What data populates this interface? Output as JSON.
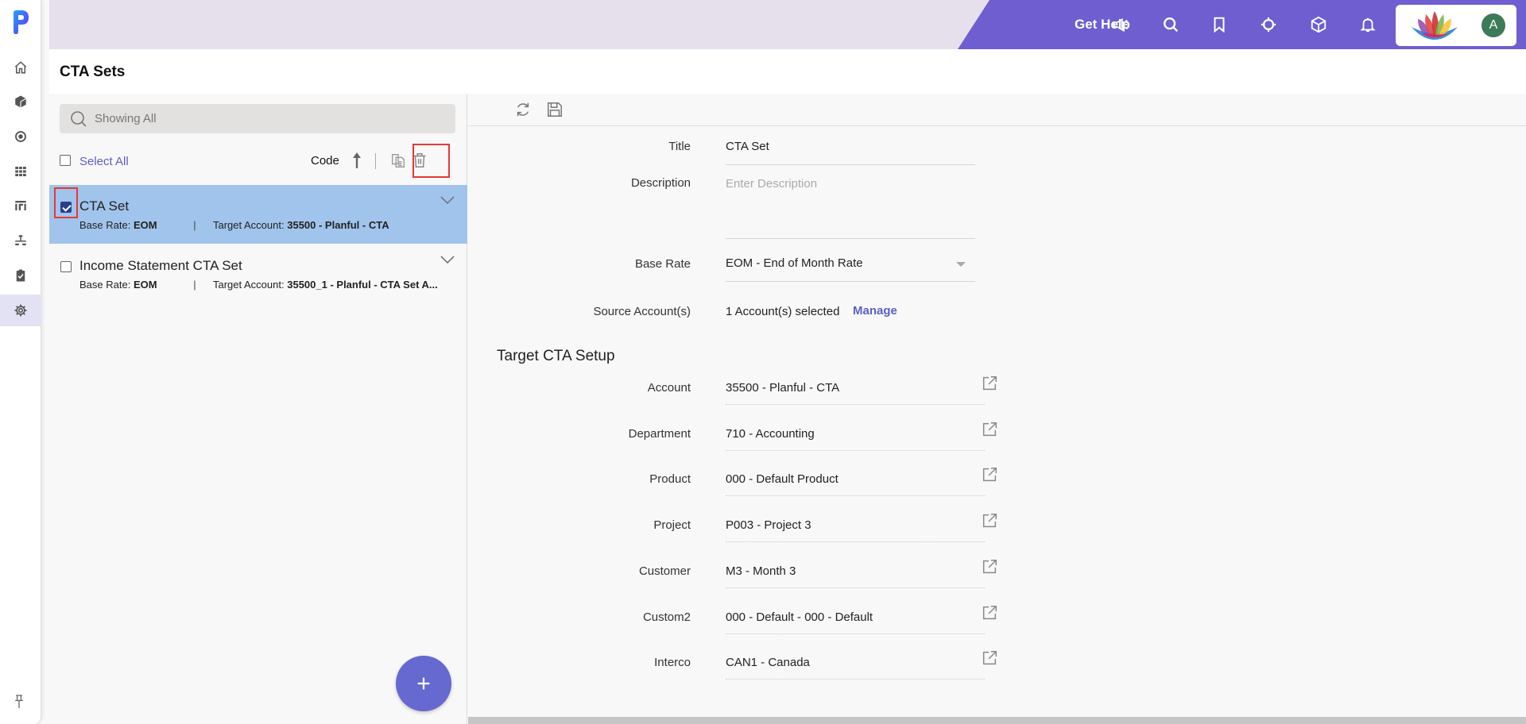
{
  "nav": {
    "items": [
      {
        "name": "home",
        "icon": "home-icon"
      },
      {
        "name": "models",
        "icon": "cube-icon"
      },
      {
        "name": "target",
        "icon": "target-icon"
      },
      {
        "name": "grid",
        "icon": "grid-icon"
      },
      {
        "name": "reports",
        "icon": "report-icon"
      },
      {
        "name": "hierarchy",
        "icon": "hierarchy-icon"
      },
      {
        "name": "tasks",
        "icon": "clipboard-check-icon"
      },
      {
        "name": "settings",
        "icon": "gear-icon",
        "active": true
      }
    ]
  },
  "header": {
    "get_help": "Get Help",
    "avatar_initial": "A",
    "icons": [
      "megaphone-icon",
      "search-icon",
      "bookmark-icon",
      "crosshair-icon",
      "box-icon",
      "bell-icon"
    ]
  },
  "page": {
    "title": "CTA Sets"
  },
  "list": {
    "search_placeholder": "Showing All",
    "select_all": "Select All",
    "sort_label": "Code",
    "items": [
      {
        "title": "CTA Set",
        "base_rate_label": "Base Rate:",
        "base_rate": "EOM",
        "target_label": "Target Account:",
        "target": "35500 - Planful - CTA",
        "checked": true,
        "selected": true
      },
      {
        "title": "Income Statement CTA Set",
        "base_rate_label": "Base Rate:",
        "base_rate": "EOM",
        "target_label": "Target Account:",
        "target": "35500_1 - Planful - CTA Set A...",
        "checked": false,
        "selected": false
      }
    ]
  },
  "detail": {
    "title_label": "Title",
    "title_value": "CTA Set",
    "description_label": "Description",
    "description_placeholder": "Enter Description",
    "base_rate_label": "Base Rate",
    "base_rate_value": "EOM - End of Month Rate",
    "source_label": "Source Account(s)",
    "source_value": "1 Account(s) selected",
    "manage_label": "Manage",
    "section_title": "Target CTA Setup",
    "target_fields": [
      {
        "label": "Account",
        "value": "35500 - Planful - CTA"
      },
      {
        "label": "Department",
        "value": "710 - Accounting"
      },
      {
        "label": "Product",
        "value": "000 - Default Product"
      },
      {
        "label": "Project",
        "value": "P003 - Project 3"
      },
      {
        "label": "Customer",
        "value": "M3 - Month 3"
      },
      {
        "label": "Custom2",
        "value": "000 - Default - 000 - Default"
      },
      {
        "label": "Interco",
        "value": "CAN1 - Canada"
      }
    ]
  },
  "colors": {
    "brand_purple": "#6e5ecf",
    "header_bg": "#e5e0ec",
    "selected_row": "#a0c4ec",
    "link": "#5b5fc7",
    "fab": "#6669d0",
    "highlight_box": "#e53935",
    "avatar": "#3d7a58"
  }
}
